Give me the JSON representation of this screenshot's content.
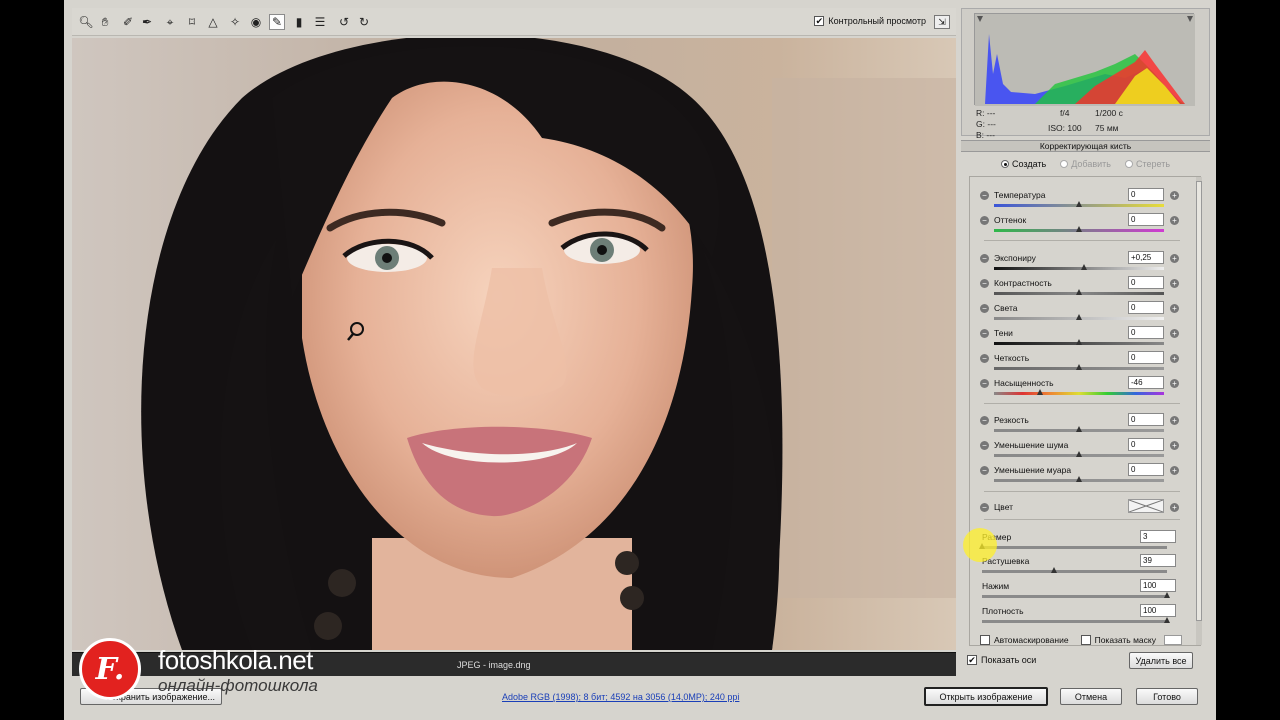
{
  "toolbar": {
    "tools": [
      "zoom-icon",
      "hand-icon",
      "white-balance-icon",
      "color-sampler-icon",
      "target-adjust-icon",
      "crop-icon",
      "straighten-icon",
      "spot-removal-icon",
      "red-eye-icon",
      "adjustment-brush-icon",
      "graduated-filter-icon",
      "preferences-icon",
      "rotate-left-icon",
      "rotate-right-icon"
    ],
    "active_tool": "adjustment-brush-icon",
    "preview_label": "Контрольный просмотр",
    "preview_checked": true
  },
  "histogram": {
    "r_label": "R:",
    "r_value": "---",
    "g_label": "G:",
    "g_value": "---",
    "b_label": "B:",
    "b_value": "---",
    "aperture": "f/4",
    "shutter": "1/200 с",
    "iso": "ISO: 100",
    "focal": "75 мм"
  },
  "panel": {
    "title": "Корректирующая кисть",
    "modes": [
      {
        "label": "Создать",
        "selected": true,
        "enabled": true
      },
      {
        "label": "Добавить",
        "selected": false,
        "enabled": false
      },
      {
        "label": "Стереть",
        "selected": false,
        "enabled": false
      }
    ],
    "adjustments": [
      {
        "label": "Температура",
        "value": "0",
        "level": 0.5
      },
      {
        "label": "Оттенок",
        "value": "0",
        "level": 0.5
      },
      {
        "label": "Экспониру",
        "value": "+0,25",
        "level": 0.53
      },
      {
        "label": "Контрастность",
        "value": "0",
        "level": 0.5
      },
      {
        "label": "Света",
        "value": "0",
        "level": 0.5
      },
      {
        "label": "Тени",
        "value": "0",
        "level": 0.5
      },
      {
        "label": "Четкость",
        "value": "0",
        "level": 0.5
      },
      {
        "label": "Насыщенность",
        "value": "-46",
        "level": 0.27
      },
      {
        "label": "Резкость",
        "value": "0",
        "level": 0.5
      },
      {
        "label": "Уменьшение шума",
        "value": "0",
        "level": 0.5
      },
      {
        "label": "Уменьшение муара",
        "value": "0",
        "level": 0.5
      }
    ],
    "color_label": "Цвет",
    "brush": [
      {
        "label": "Размер",
        "value": "3",
        "level": 0.0
      },
      {
        "label": "Растушевка",
        "value": "39",
        "level": 0.39
      },
      {
        "label": "Нажим",
        "value": "100",
        "level": 1.0
      },
      {
        "label": "Плотность",
        "value": "100",
        "level": 1.0
      }
    ],
    "automask_label": "Автомаскирование",
    "automask_checked": false,
    "show_mask_label": "Показать маску",
    "show_mask_checked": false,
    "show_pins_label": "Показать оси",
    "show_pins_checked": true,
    "clear_all_label": "Удалить все"
  },
  "status": {
    "file_label": "JPEG - image.dng",
    "workflow_link": "Adobe RGB (1998); 8 бит; 4592 на 3056 (14,0MP); 240 ppi",
    "save_label": "Сохранить изображение..."
  },
  "buttons": {
    "open": "Открыть изображение",
    "cancel": "Отмена",
    "done": "Готово"
  },
  "watermark": {
    "logo_letter": "F.",
    "site": "fotoshkola.net",
    "tagline": "онлайн-фотошкола"
  }
}
